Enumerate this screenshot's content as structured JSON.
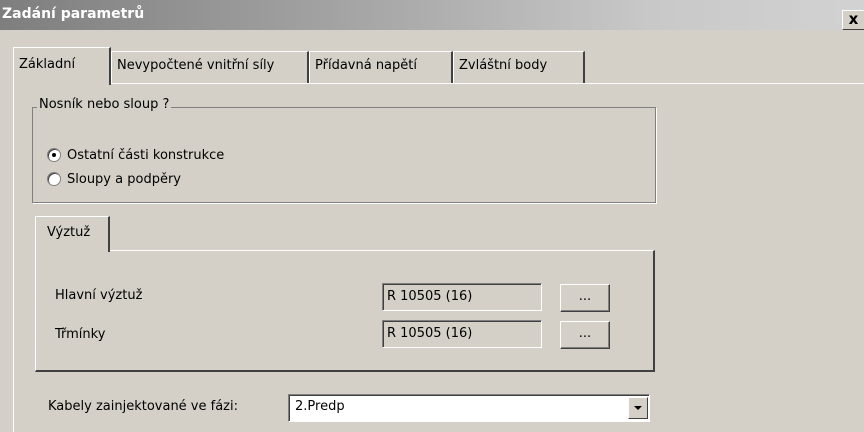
{
  "window": {
    "title": "Zadání parametrů",
    "close_label": "x"
  },
  "tabs": [
    {
      "label": "Základní",
      "active": true
    },
    {
      "label": "Nevypočtené vnitřní síly",
      "active": false
    },
    {
      "label": "Přídavná napětí",
      "active": false
    },
    {
      "label": "Zvláštní body",
      "active": false
    }
  ],
  "member_type": {
    "legend": "Nosník nebo sloup ?",
    "options": [
      {
        "label": "Ostatní části konstrukce",
        "selected": true
      },
      {
        "label": "Sloupy a podpěry",
        "selected": false
      }
    ]
  },
  "reinforcement": {
    "tab_label": "Výztuž",
    "rows": [
      {
        "label": "Hlavní výztuž",
        "value": "R 10505 (16)",
        "button_label": "..."
      },
      {
        "label": "Třmínky",
        "value": "R 10505 (16)",
        "button_label": "..."
      }
    ]
  },
  "cables": {
    "label": "Kabely zainjektované ve fázi:",
    "selected": "2.Predp"
  }
}
